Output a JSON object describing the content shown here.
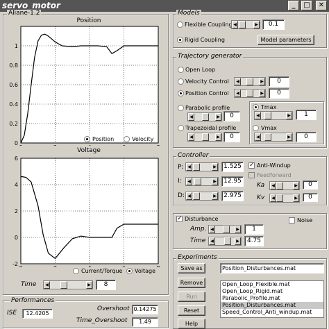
{
  "window": {
    "title": "servo_motor"
  },
  "left_frame_title": "Aliane-1.2",
  "plot1": {
    "title": "Position",
    "yticks": [
      "0",
      "0.2",
      "0.4",
      "0.6",
      "0.8",
      "1"
    ],
    "xticks": [
      "0",
      "2",
      "4",
      "6",
      "8"
    ],
    "radio_position": "Position",
    "radio_velocity": "Velocity"
  },
  "plot2": {
    "title": "Voltage",
    "yticks": [
      "-2",
      "0",
      "2",
      "4",
      "6"
    ],
    "xticks": [
      "0",
      "2",
      "4",
      "6",
      "8"
    ],
    "radio_current": "Current/Torque",
    "radio_voltage": "Voltage"
  },
  "chart_data": [
    {
      "type": "line",
      "title": "Position",
      "xlim": [
        0,
        8
      ],
      "ylim": [
        0,
        1.2
      ],
      "x": [
        0,
        0.2,
        0.4,
        0.6,
        0.8,
        1.0,
        1.2,
        1.4,
        1.6,
        2.0,
        2.4,
        3.0,
        3.5,
        4.0,
        4.5,
        5.0,
        5.3,
        5.6,
        6.0,
        6.5,
        7.0,
        7.5,
        8.0
      ],
      "y": [
        0,
        0.08,
        0.3,
        0.6,
        0.88,
        1.05,
        1.11,
        1.12,
        1.1,
        1.04,
        1.0,
        0.99,
        1.0,
        1.0,
        1.0,
        0.99,
        0.92,
        0.95,
        1.0,
        1.0,
        1.0,
        1.0,
        1.0
      ]
    },
    {
      "type": "line",
      "title": "Voltage",
      "xlim": [
        0,
        8
      ],
      "ylim": [
        -2,
        6
      ],
      "x": [
        0,
        0.1,
        0.3,
        0.6,
        1.0,
        1.3,
        1.6,
        2.0,
        2.5,
        3.0,
        3.5,
        4.0,
        4.5,
        5.0,
        5.3,
        5.6,
        6.0,
        6.5,
        7.0,
        8.0
      ],
      "y": [
        4.6,
        4.6,
        4.55,
        4.2,
        2.4,
        0.2,
        -1.2,
        -1.6,
        -0.8,
        -0.1,
        0.1,
        0.0,
        0.0,
        0.0,
        0.0,
        0.7,
        1.0,
        1.0,
        1.0,
        1.0
      ]
    }
  ],
  "time": {
    "label": "Time",
    "value": "8"
  },
  "performances": {
    "title": "Performances",
    "ise_label": "ISE",
    "ise_value": "12.4205",
    "overshoot_label": "Overshoot",
    "overshoot_value": "0.14275",
    "time_overshoot_label": "Time_Overshoot",
    "time_overshoot_value": "1.49"
  },
  "models": {
    "title": "Models",
    "flexible": "Flexible Coupling",
    "flexible_value": "0.1",
    "rigid": "Rigid Coupling",
    "params_button": "Model parameters"
  },
  "trajectory": {
    "title": "Trajectory generator",
    "open_loop": "Open Loop",
    "velocity": "Velocity Control",
    "velocity_value": "0",
    "position": "Position Control",
    "position_value": "0",
    "parabolic": "Parabolic profile",
    "parabolic_value": "0",
    "tmax": "Tmax",
    "tmax_value": "1",
    "trapezoidal": "Trapezoidal profile",
    "trapezoidal_value": "0",
    "vmax": "Vmax",
    "vmax_value": "0"
  },
  "controller": {
    "title": "Controller",
    "p_label": "P:",
    "p_value": "1.525",
    "i_label": "I:",
    "i_value": "12.95",
    "d_label": "D:",
    "d_value": "2.975",
    "antiwindup": "Anti-Windup",
    "feedforward": "Feedforward",
    "ka_label": "Ka",
    "ka_value": "0",
    "kv_label": "Kv",
    "kv_value": "0"
  },
  "disturbance": {
    "label": "Disturbance",
    "noise": "Noise",
    "amp_label": "Amp.",
    "amp_value": "1",
    "time_label": "Time",
    "time_value": "4.75"
  },
  "experiments": {
    "title": "Experiments",
    "save_as": "Save as",
    "filename": "Position_Disturbances.mat",
    "remove": "Remove",
    "run": "Run",
    "reset": "Reset",
    "help": "Help",
    "files": [
      "Open_Loop_Flexible.mat",
      "Open_Loop_Rigid.mat",
      "Parabolic_Profile.mat",
      "Position_Disturbances.mat",
      "Speed_Control_Anti_windup.mat"
    ],
    "selected_index": 3
  }
}
